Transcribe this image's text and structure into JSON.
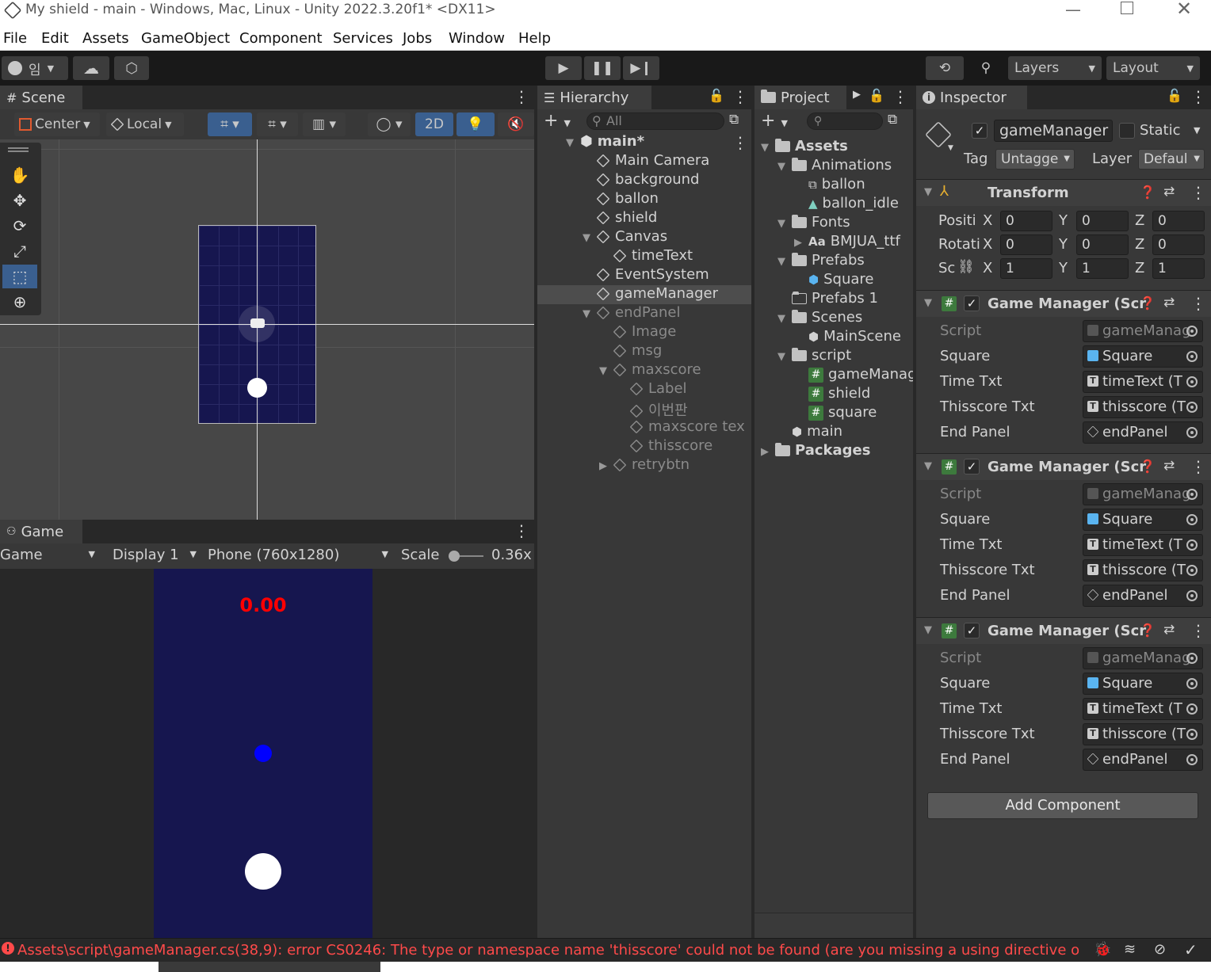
{
  "window": {
    "title": "My shield - main - Windows, Mac, Linux - Unity 2022.3.20f1* <DX11>"
  },
  "menu": [
    "File",
    "Edit",
    "Assets",
    "GameObject",
    "Component",
    "Services",
    "Jobs",
    "Window",
    "Help"
  ],
  "toolbar": {
    "account_initial": "임",
    "layers": "Layers",
    "layout": "Layout"
  },
  "scene": {
    "tab": "Scene",
    "pivot": "Center",
    "space": "Local",
    "mode_2d": "2D"
  },
  "game": {
    "tab": "Game",
    "view": "Game",
    "display": "Display 1",
    "resolution": "Phone (760x1280)",
    "scale_label": "Scale",
    "scale_value": "0.36x",
    "time_text": "0.00"
  },
  "hierarchy": {
    "tab": "Hierarchy",
    "search_placeholder": "All",
    "items": [
      {
        "label": "main*",
        "depth": 0,
        "expand": "open",
        "kind": "scene",
        "dim": false
      },
      {
        "label": "Main Camera",
        "depth": 1,
        "expand": "",
        "kind": "go",
        "dim": false
      },
      {
        "label": "background",
        "depth": 1,
        "expand": "",
        "kind": "go",
        "dim": false
      },
      {
        "label": "ballon",
        "depth": 1,
        "expand": "",
        "kind": "go",
        "dim": false
      },
      {
        "label": "shield",
        "depth": 1,
        "expand": "",
        "kind": "go",
        "dim": false
      },
      {
        "label": "Canvas",
        "depth": 1,
        "expand": "open",
        "kind": "go",
        "dim": false
      },
      {
        "label": "timeText",
        "depth": 2,
        "expand": "",
        "kind": "go",
        "dim": false
      },
      {
        "label": "EventSystem",
        "depth": 1,
        "expand": "",
        "kind": "go",
        "dim": false
      },
      {
        "label": "gameManager",
        "depth": 1,
        "expand": "",
        "kind": "go",
        "dim": false,
        "selected": true
      },
      {
        "label": "endPanel",
        "depth": 1,
        "expand": "open",
        "kind": "go",
        "dim": true
      },
      {
        "label": "Image",
        "depth": 2,
        "expand": "",
        "kind": "go",
        "dim": true
      },
      {
        "label": "msg",
        "depth": 2,
        "expand": "",
        "kind": "go",
        "dim": true
      },
      {
        "label": "maxscore",
        "depth": 2,
        "expand": "open",
        "kind": "go",
        "dim": true
      },
      {
        "label": "Label",
        "depth": 3,
        "expand": "",
        "kind": "go",
        "dim": true
      },
      {
        "label": "이번판",
        "depth": 3,
        "expand": "",
        "kind": "go",
        "dim": true
      },
      {
        "label": "maxscore tex",
        "depth": 3,
        "expand": "",
        "kind": "go",
        "dim": true
      },
      {
        "label": "thisscore",
        "depth": 3,
        "expand": "",
        "kind": "go",
        "dim": true
      },
      {
        "label": "retrybtn",
        "depth": 2,
        "expand": "closed",
        "kind": "go",
        "dim": true
      }
    ]
  },
  "project": {
    "tab": "Project",
    "items": [
      {
        "label": "Assets",
        "depth": 0,
        "expand": "open",
        "kind": "folder",
        "bold": true
      },
      {
        "label": "Animations",
        "depth": 1,
        "expand": "open",
        "kind": "folder"
      },
      {
        "label": "ballon",
        "depth": 2,
        "expand": "",
        "kind": "anim"
      },
      {
        "label": "ballon_idle",
        "depth": 2,
        "expand": "",
        "kind": "clip"
      },
      {
        "label": "Fonts",
        "depth": 1,
        "expand": "open",
        "kind": "folder"
      },
      {
        "label": "BMJUA_ttf",
        "depth": 2,
        "expand": "closed",
        "kind": "font"
      },
      {
        "label": "Prefabs",
        "depth": 1,
        "expand": "open",
        "kind": "folder"
      },
      {
        "label": "Square",
        "depth": 2,
        "expand": "",
        "kind": "prefab"
      },
      {
        "label": "Prefabs 1",
        "depth": 1,
        "expand": "",
        "kind": "folder-empty"
      },
      {
        "label": "Scenes",
        "depth": 1,
        "expand": "open",
        "kind": "folder"
      },
      {
        "label": "MainScene",
        "depth": 2,
        "expand": "",
        "kind": "scene"
      },
      {
        "label": "script",
        "depth": 1,
        "expand": "open",
        "kind": "folder"
      },
      {
        "label": "gameManag",
        "depth": 2,
        "expand": "",
        "kind": "script"
      },
      {
        "label": "shield",
        "depth": 2,
        "expand": "",
        "kind": "script"
      },
      {
        "label": "square",
        "depth": 2,
        "expand": "",
        "kind": "script"
      },
      {
        "label": "main",
        "depth": 1,
        "expand": "",
        "kind": "scene"
      },
      {
        "label": "Packages",
        "depth": 0,
        "expand": "closed",
        "kind": "folder",
        "bold": true
      }
    ]
  },
  "inspector": {
    "tab": "Inspector",
    "object_name": "gameManager",
    "static_label": "Static",
    "tag_label": "Tag",
    "tag_value": "Untagge",
    "layer_label": "Layer",
    "layer_value": "Defaul",
    "transform": {
      "title": "Transform",
      "position_label": "Positi",
      "rotation_label": "Rotati",
      "scale_label": "Sc",
      "position": [
        "0",
        "0",
        "0"
      ],
      "rotation": [
        "0",
        "0",
        "0"
      ],
      "scale": [
        "1",
        "1",
        "1"
      ],
      "axis": [
        "X",
        "Y",
        "Z"
      ]
    },
    "components": [
      {
        "title": "Game Manager (Scr",
        "fields": [
          {
            "label": "Script",
            "value": "gameManag",
            "icon": "script",
            "dim": true
          },
          {
            "label": "Square",
            "value": "Square",
            "icon": "prefab"
          },
          {
            "label": "Time Txt",
            "value": "timeText (T",
            "icon": "text"
          },
          {
            "label": "Thisscore Txt",
            "value": "thisscore (T",
            "icon": "text"
          },
          {
            "label": "End Panel",
            "value": "endPanel",
            "icon": "go"
          }
        ]
      },
      {
        "title": "Game Manager (Scr",
        "fields": [
          {
            "label": "Script",
            "value": "gameManag",
            "icon": "script",
            "dim": true
          },
          {
            "label": "Square",
            "value": "Square",
            "icon": "prefab"
          },
          {
            "label": "Time Txt",
            "value": "timeText (T",
            "icon": "text"
          },
          {
            "label": "Thisscore Txt",
            "value": "thisscore (T",
            "icon": "text"
          },
          {
            "label": "End Panel",
            "value": "endPanel",
            "icon": "go"
          }
        ]
      },
      {
        "title": "Game Manager (Scr",
        "fields": [
          {
            "label": "Script",
            "value": "gameManag",
            "icon": "script",
            "dim": true
          },
          {
            "label": "Square",
            "value": "Square",
            "icon": "prefab"
          },
          {
            "label": "Time Txt",
            "value": "timeText (T",
            "icon": "text"
          },
          {
            "label": "Thisscore Txt",
            "value": "thisscore (T",
            "icon": "text"
          },
          {
            "label": "End Panel",
            "value": "endPanel",
            "icon": "go"
          }
        ]
      }
    ],
    "add_component": "Add Component"
  },
  "status": {
    "error": "Assets\\script\\gameManager.cs(38,9): error CS0246: The type or namespace name 'thisscore' could not be found (are you missing a using directive o"
  },
  "colors": {
    "panel": "#383838",
    "selection": "#4d4d4d",
    "accent_blue": "#3a5f8f",
    "game_bg": "#16164f",
    "error_red": "#ff4a4a",
    "time_red": "#ff0000"
  }
}
